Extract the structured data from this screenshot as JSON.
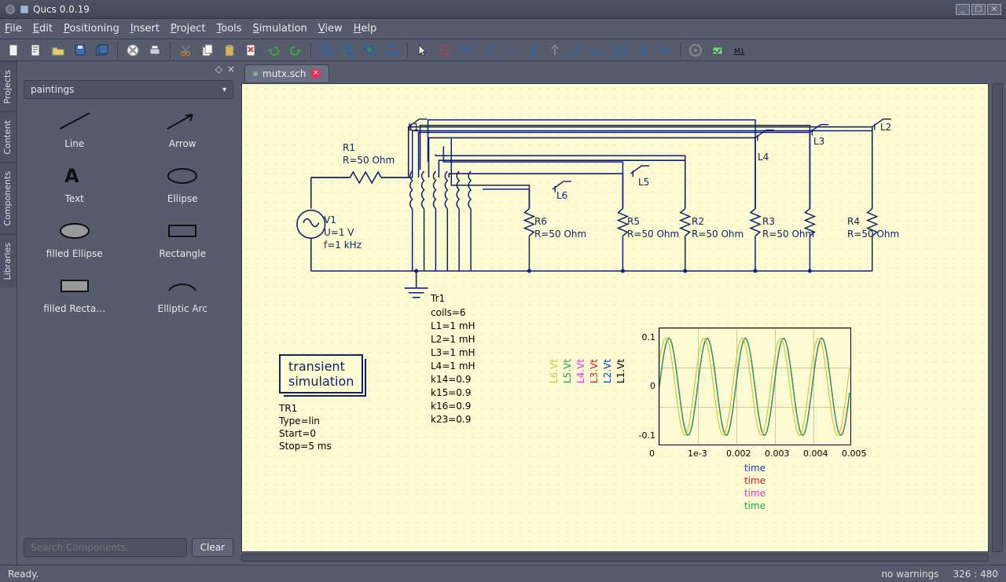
{
  "window": {
    "title": "Qucs 0.0.19"
  },
  "menubar": [
    {
      "key": "F",
      "rest": "ile"
    },
    {
      "key": "E",
      "rest": "dit"
    },
    {
      "key": "P",
      "rest": "ositioning"
    },
    {
      "key": "I",
      "rest": "nsert"
    },
    {
      "key": "P",
      "rest": "roject"
    },
    {
      "key": "T",
      "rest": "ools"
    },
    {
      "key": "S",
      "rest": "imulation"
    },
    {
      "key": "V",
      "rest": "iew"
    },
    {
      "key": "H",
      "rest": "elp"
    }
  ],
  "side": {
    "tabs": [
      "Projects",
      "Content",
      "Components",
      "Libraries"
    ],
    "combo": "paintings",
    "items": [
      {
        "label": "Line"
      },
      {
        "label": "Arrow"
      },
      {
        "label": "Text"
      },
      {
        "label": "Ellipse"
      },
      {
        "label": "filled Ellipse"
      },
      {
        "label": "Rectangle"
      },
      {
        "label": "filled Recta…"
      },
      {
        "label": "Elliptic Arc"
      }
    ],
    "search_placeholder": "Search Components",
    "clear": "Clear"
  },
  "tab": {
    "name": "mutx.sch"
  },
  "schematic": {
    "r1": {
      "name": "R1",
      "val": "R=50 Ohm"
    },
    "v1": {
      "name": "V1",
      "u": "U=1 V",
      "f": "f=1 kHz"
    },
    "r6": {
      "name": "R6",
      "val": "R=50 Ohm"
    },
    "r5": {
      "name": "R5",
      "val": "R=50 Ohm"
    },
    "r2": {
      "name": "R2",
      "val": "R=50 Ohm"
    },
    "r3": {
      "name": "R3",
      "val": "R=50 Ohm"
    },
    "r4": {
      "name": "R4",
      "val": "R=50 Ohm"
    },
    "labels": [
      "L1",
      "L2",
      "L3",
      "L4",
      "L5",
      "L6"
    ],
    "sim": {
      "title1": "transient",
      "title2": "simulation",
      "name": "TR1",
      "type": "Type=lin",
      "start": "Start=0",
      "stop": "Stop=5 ms"
    },
    "tr1": {
      "name": "Tr1",
      "lines": [
        "coils=6",
        "L1=1 mH",
        "L2=1 mH",
        "L3=1 mH",
        "L4=1 mH",
        "k14=0.9",
        "k15=0.9",
        "k16=0.9",
        "k23=0.9"
      ]
    },
    "legend_series": [
      {
        "name": "L6.Vt",
        "color": "#c9c93e"
      },
      {
        "name": "L5.Vt",
        "color": "#1fa650"
      },
      {
        "name": "L4.Vt",
        "color": "#d63cc3"
      },
      {
        "name": "L3.Vt",
        "color": "#d02020"
      },
      {
        "name": "L2.Vt",
        "color": "#1040c0"
      },
      {
        "name": "L1.Vt",
        "color": "#000000"
      }
    ],
    "time_labels": [
      {
        "text": "time",
        "color": "#1040c0"
      },
      {
        "text": "time",
        "color": "#d02020"
      },
      {
        "text": "time",
        "color": "#d63cc3"
      },
      {
        "text": "time",
        "color": "#1fa650"
      }
    ]
  },
  "chart_data": {
    "type": "line",
    "title": "",
    "xlabel": "time",
    "ylabel": "",
    "xlim": [
      0,
      0.005
    ],
    "ylim": [
      -0.12,
      0.12
    ],
    "xticks": [
      0,
      0.001,
      0.002,
      0.003,
      0.004,
      0.005
    ],
    "xtick_labels": [
      "0",
      "1e-3",
      "0.002",
      "0.003",
      "0.004",
      "0.005"
    ],
    "yticks": [
      -0.1,
      0,
      0.1
    ],
    "series": [
      {
        "name": "L1.Vt",
        "color": "#000000",
        "amplitude": 0.1,
        "freq_hz": 1000,
        "phase_deg": 0
      },
      {
        "name": "L2.Vt",
        "color": "#1040c0",
        "amplitude": 0.1,
        "freq_hz": 1000,
        "phase_deg": 0
      },
      {
        "name": "L3.Vt",
        "color": "#d02020",
        "amplitude": 0.1,
        "freq_hz": 1000,
        "phase_deg": 0
      },
      {
        "name": "L4.Vt",
        "color": "#d63cc3",
        "amplitude": 0.1,
        "freq_hz": 1000,
        "phase_deg": 0
      },
      {
        "name": "L5.Vt",
        "color": "#1fa650",
        "amplitude": 0.1,
        "freq_hz": 1000,
        "phase_deg": 0
      },
      {
        "name": "L6.Vt",
        "color": "#c9c93e",
        "amplitude": 0.1,
        "freq_hz": 1000,
        "phase_deg": 30
      }
    ]
  },
  "status": {
    "ready": "Ready.",
    "warn": "no warnings",
    "coords": "326 : 480"
  }
}
